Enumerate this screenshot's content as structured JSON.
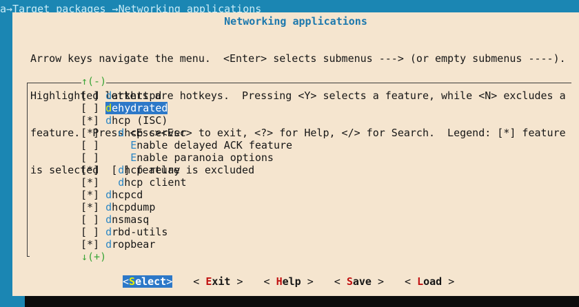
{
  "breadcrumb": "a→Target packages →Networking applications",
  "dialog": {
    "title": "Networking applications",
    "help_lines": [
      "Arrow keys navigate the menu.  <Enter> selects submenus ---> (or empty submenus ----).",
      "Highlighted letters are hotkeys.  Pressing <Y> selects a feature, while <N> excludes a",
      "feature.  Press <Esc><Esc> to exit, <?> for Help, </> for Search.  Legend: [*] feature",
      "is selected  [ ] feature is excluded"
    ]
  },
  "menu": {
    "scroll_up": "↑(-)",
    "scroll_down": "↓(+)",
    "items": [
      {
        "state": "[ ]",
        "indent": "",
        "hotkey": "d",
        "rest": "arkhttpd"
      },
      {
        "state": "[ ]",
        "indent": "",
        "hotkey": "d",
        "rest": "ehydrated"
      },
      {
        "state": "[*]",
        "indent": "",
        "hotkey": "d",
        "rest": "hcp (ISC)"
      },
      {
        "state": "[*]",
        "indent": "  ",
        "hotkey": "d",
        "rest": "hcp server"
      },
      {
        "state": "[ ]",
        "indent": "    ",
        "hotkey": "E",
        "rest": "nable delayed ACK feature"
      },
      {
        "state": "[ ]",
        "indent": "    ",
        "hotkey": "E",
        "rest": "nable paranoia options"
      },
      {
        "state": "[*]",
        "indent": "  ",
        "hotkey": "d",
        "rest": "hcp relay"
      },
      {
        "state": "[*]",
        "indent": "  ",
        "hotkey": "d",
        "rest": "hcp client"
      },
      {
        "state": "[*]",
        "indent": "",
        "hotkey": "d",
        "rest": "hcpcd"
      },
      {
        "state": "[*]",
        "indent": "",
        "hotkey": "d",
        "rest": "hcpdump"
      },
      {
        "state": "[ ]",
        "indent": "",
        "hotkey": "d",
        "rest": "nsmasq"
      },
      {
        "state": "[ ]",
        "indent": "",
        "hotkey": "d",
        "rest": "rbd-utils"
      },
      {
        "state": "[*]",
        "indent": "",
        "hotkey": "d",
        "rest": "ropbear"
      }
    ]
  },
  "buttons": [
    {
      "left": "<",
      "hotkey": "S",
      "rest": "elect",
      "right": ">"
    },
    {
      "left": "< ",
      "hotkey": "E",
      "rest": "xit",
      "right": " >"
    },
    {
      "left": "< ",
      "hotkey": "H",
      "rest": "elp",
      "right": " >"
    },
    {
      "left": "< ",
      "hotkey": "S",
      "rest": "ave",
      "right": " >"
    },
    {
      "left": "< ",
      "hotkey": "L",
      "rest": "oad",
      "right": " >"
    }
  ],
  "colors": {
    "background": "#1b86b3",
    "dialog": "#f5e5cf",
    "title": "#1c78ad",
    "highlight": "#2c78c8",
    "hotkey": "#2b86c4",
    "scroll_arrow": "#3aa538"
  }
}
